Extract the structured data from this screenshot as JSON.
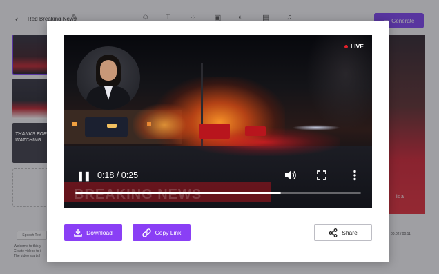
{
  "editor": {
    "project_title": "Red Breaking News",
    "generate_label": "Generate",
    "thumb_text": "THANKS FOR WATCHING",
    "speech_tab": "Speech Text",
    "script_lines": [
      "Welcome to this y",
      "Create videos to i",
      "The video starts h"
    ],
    "right_text": "is a",
    "timecode": "00:02 / 00:11"
  },
  "modal": {
    "live_label": "LIVE",
    "player": {
      "current_time": "0:18",
      "duration": "0:25",
      "time_display": "0:18 / 0:25",
      "progress_fraction": 0.72
    },
    "lower_third_text": "BREAKING NEWS",
    "buttons": {
      "download": "Download",
      "copy_link": "Copy Link",
      "share": "Share"
    }
  },
  "colors": {
    "accent": "#8a3ff5",
    "live_dot": "#e2202a"
  },
  "icons": {
    "download": "download-icon",
    "copy_link": "link-icon",
    "share": "share-icon",
    "pause": "pause-icon",
    "volume": "volume-icon",
    "fullscreen": "fullscreen-icon",
    "more": "more-vertical-icon"
  }
}
